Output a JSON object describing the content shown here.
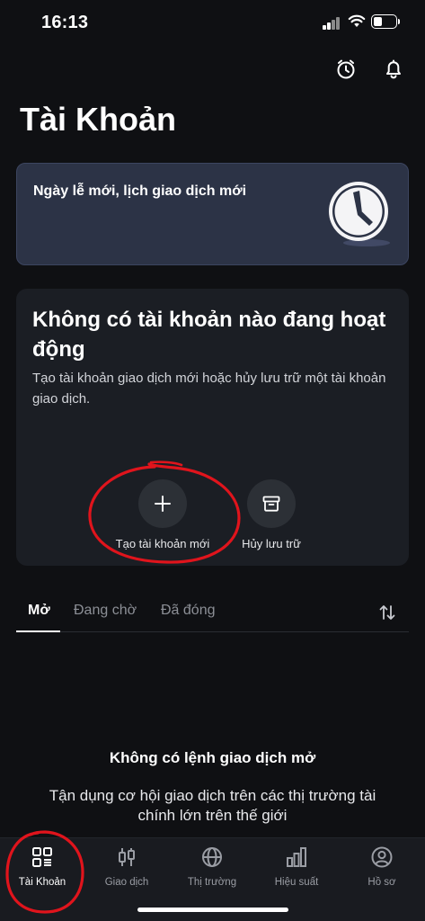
{
  "status_bar": {
    "time": "16:13"
  },
  "header": {
    "title": "Tài Khoản"
  },
  "banner": {
    "text": "Ngày lễ mới, lịch giao dịch mới"
  },
  "empty_accounts": {
    "title": "Không có tài khoản nào đang hoạt động",
    "description": "Tạo tài khoản giao dịch mới hoặc hủy lưu trữ một tài khoản giao dịch.",
    "actions": [
      {
        "label": "Tạo tài khoản mới",
        "icon": "plus-icon"
      },
      {
        "label": "Hủy lưu trữ",
        "icon": "archive-icon"
      }
    ]
  },
  "tabs": [
    {
      "label": "Mở",
      "active": true
    },
    {
      "label": "Đang chờ",
      "active": false
    },
    {
      "label": "Đã đóng",
      "active": false
    }
  ],
  "empty_orders": {
    "title": "Không có lệnh giao dịch mở",
    "description": "Tận dụng cơ hội giao dịch trên các thị trường tài chính lớn trên thế giới"
  },
  "bottom_nav": [
    {
      "label": "Tài Khoản",
      "icon": "grid-icon",
      "active": true
    },
    {
      "label": "Giao dịch",
      "icon": "candlestick-icon",
      "active": false
    },
    {
      "label": "Thị trường",
      "icon": "globe-icon",
      "active": false
    },
    {
      "label": "Hiệu suất",
      "icon": "bar-chart-icon",
      "active": false
    },
    {
      "label": "Hồ sơ",
      "icon": "profile-icon",
      "active": false
    }
  ],
  "colors": {
    "background": "#0f1013",
    "banner_background": "#2c3346",
    "card_background": "#1b1e24",
    "annotation_red": "#e0141c",
    "nav_background": "#191b20"
  }
}
